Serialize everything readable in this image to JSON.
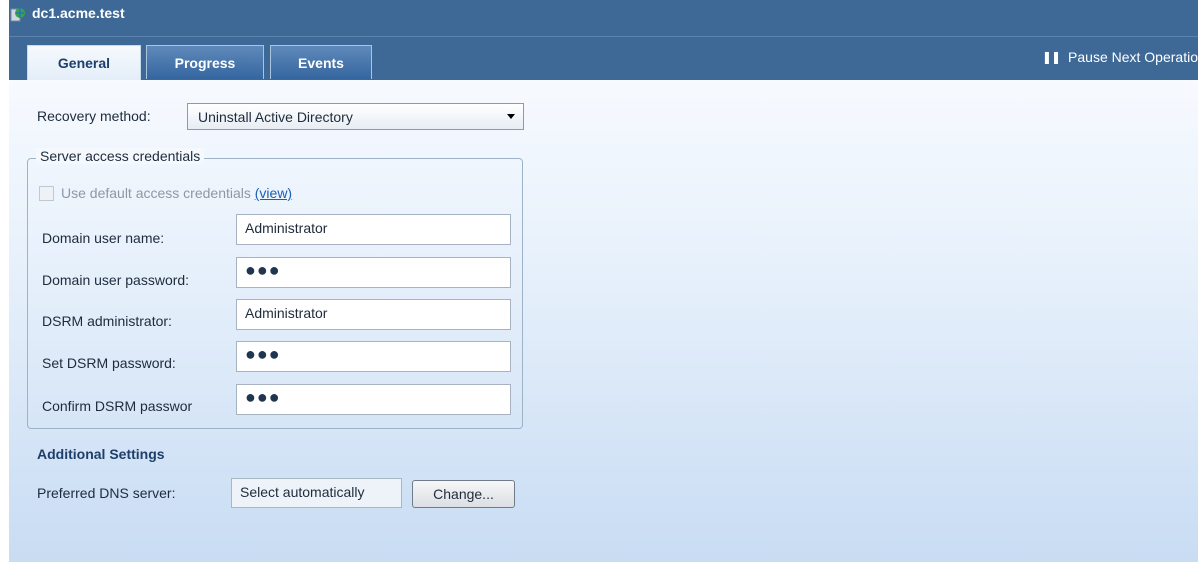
{
  "window": {
    "title": "dc1.acme.test"
  },
  "tabs": [
    {
      "label": "General",
      "active": true
    },
    {
      "label": "Progress",
      "active": false
    },
    {
      "label": "Events",
      "active": false
    }
  ],
  "toolbar": {
    "pause_label": "Pause Next Operatio",
    "pause_icon": "pause-icon"
  },
  "recovery": {
    "label": "Recovery method:",
    "selected": "Uninstall Active Directory"
  },
  "credentials": {
    "group_label": "Server access credentials",
    "use_default_label": "Use default access credentials",
    "view_link": "(view)",
    "use_default_checked": false,
    "fields": [
      {
        "label": "Domain user name:",
        "value": "Administrator",
        "masked": false
      },
      {
        "label": "Domain user password:",
        "value": "●●●",
        "masked": true
      },
      {
        "label": "DSRM administrator:",
        "value": "Administrator",
        "masked": false
      },
      {
        "label": "Set DSRM password:",
        "value": "●●●",
        "masked": true
      },
      {
        "label": "Confirm DSRM passwor",
        "value": "●●●",
        "masked": true
      }
    ]
  },
  "additional": {
    "title": "Additional Settings",
    "dns_label": "Preferred DNS server:",
    "dns_value": "Select automatically",
    "change_button": "Change..."
  },
  "colors": {
    "titlebar": "#3e6896",
    "accent_link": "#1a5fb4",
    "section_title": "#1d3f6a"
  }
}
